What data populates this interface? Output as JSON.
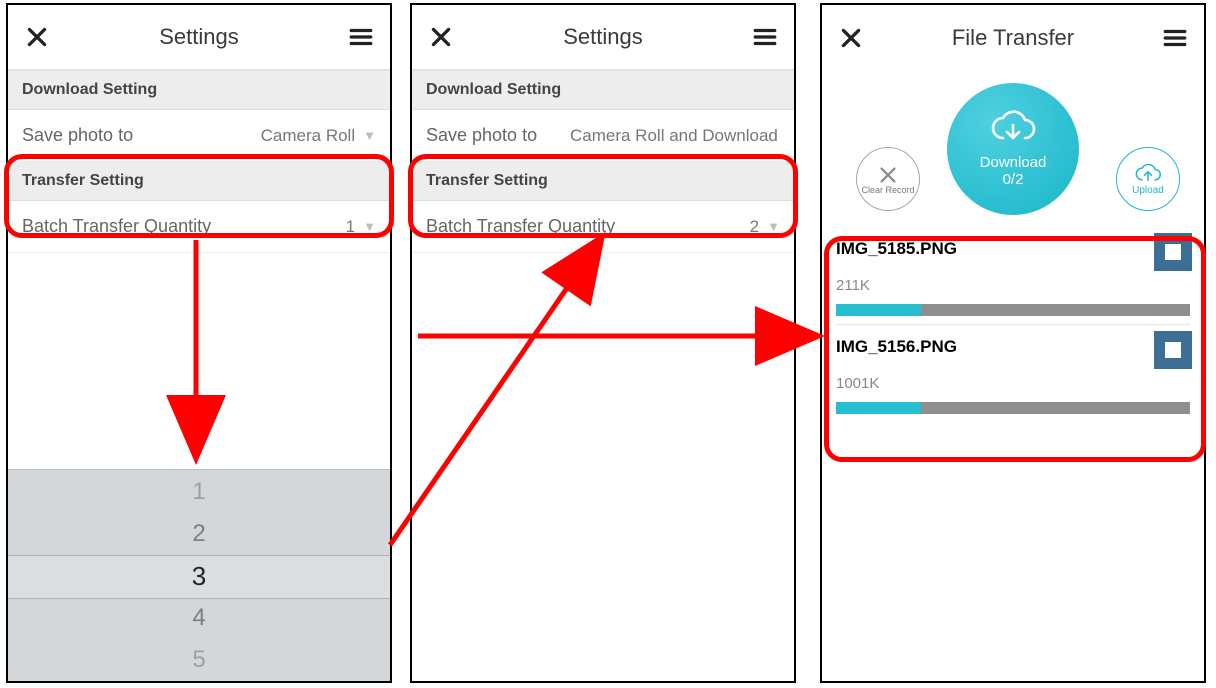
{
  "screens": {
    "settings1": {
      "title": "Settings",
      "download_section": "Download Setting",
      "save_photo_label": "Save photo to",
      "save_photo_value": "Camera Roll",
      "transfer_section": "Transfer Setting",
      "batch_label": "Batch Transfer Quantity",
      "batch_value": "1",
      "picker": {
        "opts": [
          "1",
          "2",
          "3",
          "4",
          "5"
        ],
        "selected_index": 2
      }
    },
    "settings2": {
      "title": "Settings",
      "download_section": "Download Setting",
      "save_photo_label": "Save photo to",
      "save_photo_value": "Camera Roll and Download",
      "transfer_section": "Transfer Setting",
      "batch_label": "Batch Transfer Quantity",
      "batch_value": "2"
    },
    "transfer": {
      "title": "File Transfer",
      "download_label": "Download",
      "download_progress": "0/2",
      "clear_label": "Clear Record",
      "upload_label": "Upload",
      "items": [
        {
          "name": "IMG_5185.PNG",
          "size": "211K",
          "progress_pct": 24
        },
        {
          "name": "IMG_5156.PNG",
          "size": "1001K",
          "progress_pct": 24
        }
      ]
    }
  },
  "highlight_color": "#ff0000"
}
